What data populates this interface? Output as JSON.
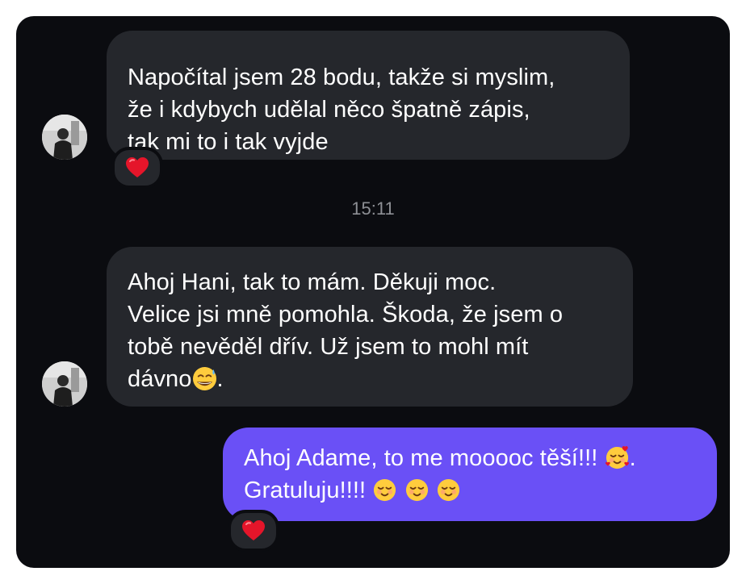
{
  "conversation": {
    "messages": [
      {
        "direction": "incoming",
        "text": "Napočítal jsem 28 bodu, takže si myslim,\nže i kdybych udělal něco špatně zápis,\ntak mi to i tak vyjde",
        "reaction_icon": "red-heart-icon"
      },
      {
        "direction": "incoming",
        "text_line1": "Ahoj Hani, tak to mám. Děkuji moc.",
        "text_line2": "Velice jsi mně pomohla. Škoda, že jsem o",
        "text_line3": "tobě nevěděl dřív. Už jsem to mohl mít",
        "text_line4_prefix": "dávno",
        "text_line4_suffix": ".",
        "emoji_icon": "grinning-sweat-emoji-icon"
      },
      {
        "direction": "outgoing",
        "text_line1_prefix": "Ahoj Adame, to me mooooc těší!!!",
        "text_line1_suffix": ".",
        "text_line2_prefix": "Gratuluju!!!!",
        "reaction_icon": "red-heart-icon",
        "color": "#6a50f6"
      }
    ],
    "timestamp": "15:11"
  },
  "colors": {
    "background": "#0b0c10",
    "incoming_bubble": "#25272c",
    "outgoing_bubble": "#6a50f6",
    "timestamp_text": "#8d8f94"
  }
}
